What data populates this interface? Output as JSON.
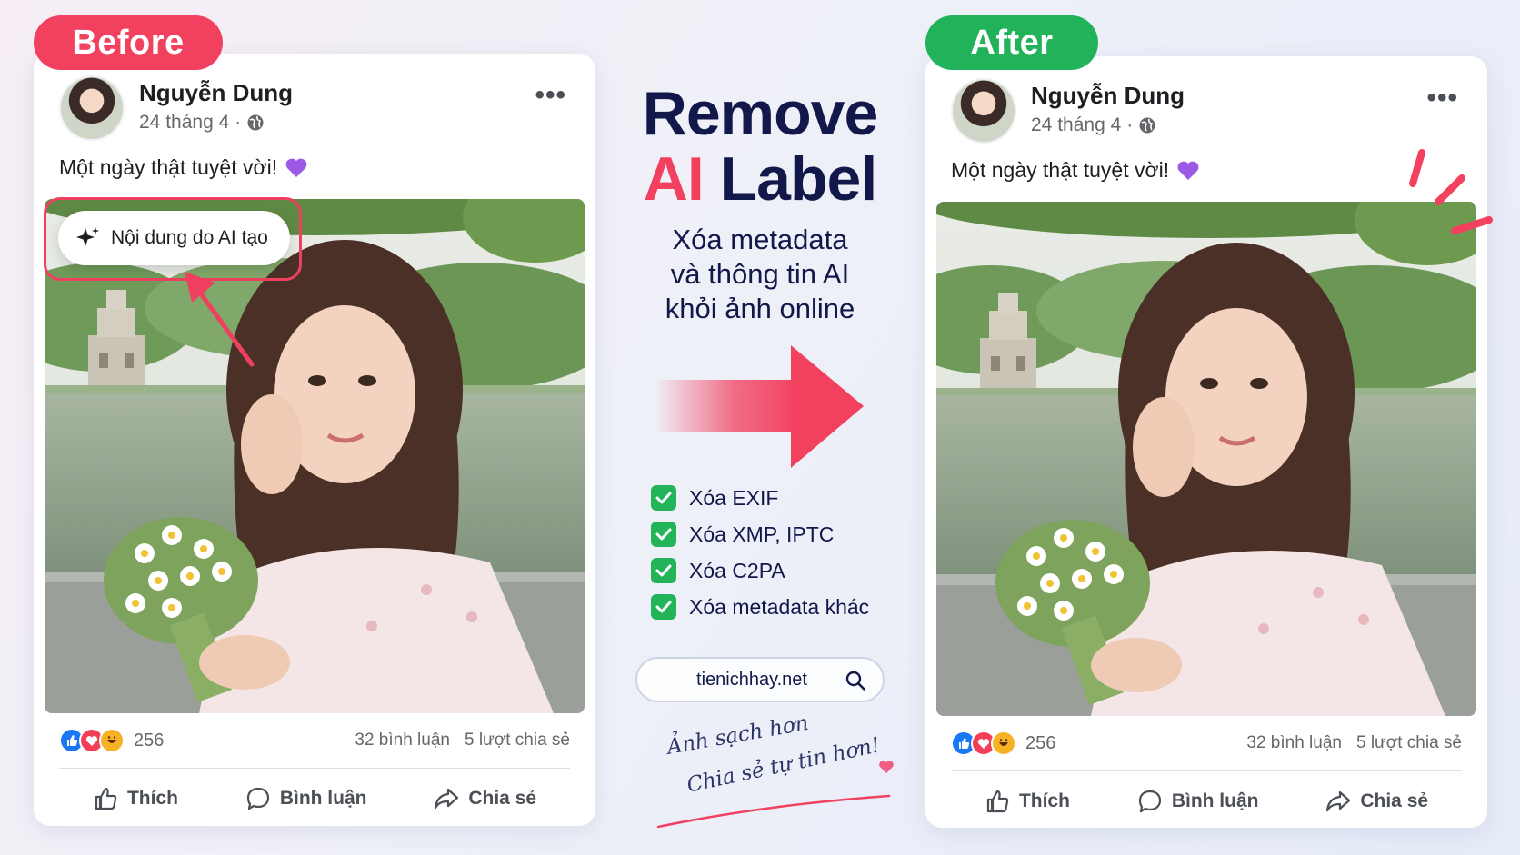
{
  "colors": {
    "before_tag": "#f2405f",
    "after_tag": "#22b25a",
    "headline": "#12194a",
    "accent_red": "#f2405f",
    "check_green": "#23b45a",
    "facebook_blue": "#1877f2"
  },
  "before_label": "Before",
  "after_label": "After",
  "post": {
    "author": "Nguyễn Dung",
    "date": "24 tháng 4",
    "separator": "·",
    "caption": "Một ngày thật tuyệt vời!",
    "reaction_count": "256",
    "comments": "32 bình luận",
    "shares": "5 lượt chia sẻ",
    "actions": {
      "like": "Thích",
      "comment": "Bình luận",
      "share": "Chia sẻ"
    }
  },
  "ai_label": "Nội dung do AI tạo",
  "headline": {
    "line1": "Remove",
    "ai": "AI",
    "label": "Label"
  },
  "subtitle": {
    "line1": "Xóa metadata",
    "line2": "và thông tin AI",
    "line3": "khỏi ảnh online"
  },
  "checklist": [
    "Xóa EXIF",
    "Xóa XMP, IPTC",
    "Xóa C2PA",
    "Xóa metadata khác"
  ],
  "site": "tienichhay.net",
  "handwriting": {
    "line1": "Ảnh sạch hơn",
    "line2": "Chia sẻ tự tin hơn!"
  },
  "icons": {
    "globe": "globe-icon",
    "heart": "purple-heart-icon",
    "sparkle": "sparkle-icon",
    "search": "search-icon",
    "more": "more-dots-icon"
  }
}
